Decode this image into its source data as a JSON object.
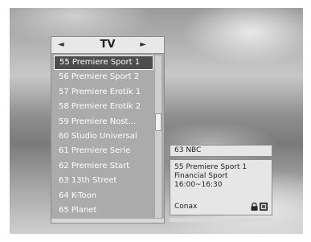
{
  "channel_list": {
    "title": "TV",
    "prev_arrow": "◄",
    "next_arrow": "►",
    "items": [
      "55 Premiere Sport 1",
      "56 Premiere Sport 2",
      "57 Premiere Erotik 1",
      "58 Premiere Erotik 2",
      "59 Premiere Nost…",
      "60 Studio Universal",
      "61 Premiere Serie",
      "62 Premiere Start",
      "63 13th Street",
      "64 K-Toon",
      "65 Planet"
    ],
    "selected_index": 0
  },
  "info_panel": {
    "header": "63 NBC",
    "channel": "55 Premiere Sport 1",
    "program": "Financial Sport",
    "time": "16:00~16:30",
    "ca_system": "Conax",
    "icons": [
      "lock-icon",
      "scrambled-icon"
    ]
  }
}
